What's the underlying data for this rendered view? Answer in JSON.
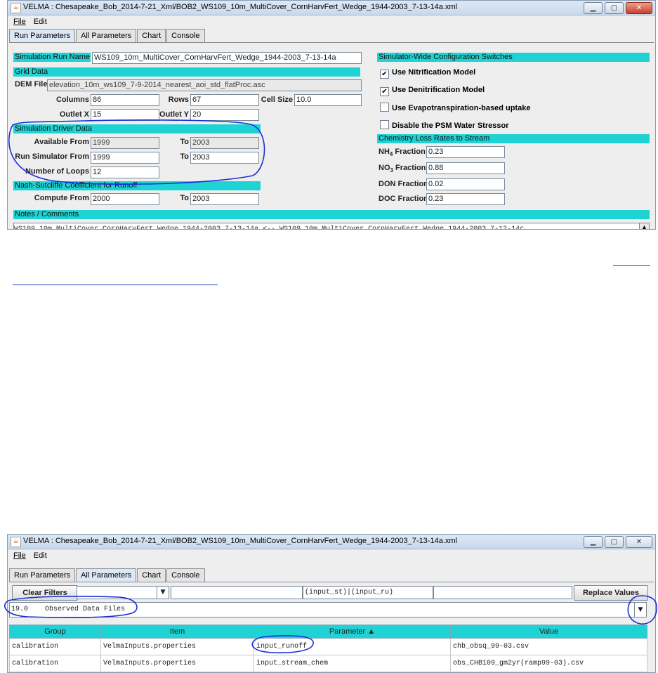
{
  "window1": {
    "title": "VELMA : Chesapeake_Bob_2014-7-21_Xml/BOB2_WS109_10m_MultiCover_CornHarvFert_Wedge_1944-2003_7-13-14a.xml",
    "menu": [
      "File",
      "Edit"
    ],
    "tabs": [
      "Run Parameters",
      "All Parameters",
      "Chart",
      "Console"
    ],
    "active_tab": "Run Parameters",
    "sim_run_name_label": "Simulation Run Name",
    "sim_run_name_value": "WS109_10m_MultiCover_CornHarvFert_Wedge_1944-2003_7-13-14a",
    "grid_data_header": "Grid Data",
    "dem_file_label": "DEM File",
    "dem_file_value": "elevation_10m_ws109_7-9-2014_nearest_aoi_std_flatProc.asc",
    "columns_label": "Columns",
    "columns_value": "86",
    "rows_label": "Rows",
    "rows_value": "67",
    "cell_size_label": "Cell Size",
    "cell_size_value": "10.0",
    "outlet_x_label": "Outlet X",
    "outlet_x_value": "15",
    "outlet_y_label": "Outlet Y",
    "outlet_y_value": "20",
    "driver_header": "Simulation Driver Data",
    "available_from_label": "Available From",
    "available_from_value": "1999",
    "available_to_label": "To",
    "available_to_value": "2003",
    "run_from_label": "Run Simulator From",
    "run_from_value": "1999",
    "run_to_label": "To",
    "run_to_value": "2003",
    "loops_label": "Number of Loops",
    "loops_value": "12",
    "nash_header": "Nash-Sutcliffe Coefficient for Runoff",
    "compute_from_label": "Compute From",
    "compute_from_value": "2000",
    "compute_to_label": "To",
    "compute_to_value": "2003",
    "switches_header": "Simulator-Wide Configuration Switches",
    "switches": [
      {
        "label": "Use Nitrification Model",
        "checked": true
      },
      {
        "label": "Use Denitrification Model",
        "checked": true
      },
      {
        "label": "Use Evapotranspiration-based uptake",
        "checked": false
      },
      {
        "label": "Disable the PSM Water Stressor",
        "checked": false
      }
    ],
    "chem_header": "Chemistry Loss Rates to Stream",
    "nh4_main": "NH",
    "nh4_sub": "4",
    "nh4_rest": " Fraction",
    "nh4_value": "0.23",
    "no3_main": "NO",
    "no3_sub": "3",
    "no3_rest": " Fraction",
    "no3_value": "0.88",
    "don_label": "DON Fraction",
    "don_value": "0.02",
    "doc_label": "DOC Fraction",
    "doc_value": "0.23",
    "notes_header": "Notes / Comments",
    "notes_text": "WS109_10m_MultiCover_CornHarvFert_Wedge_1944-2003_7-13-14a <-- WS109_10m_MultiCover_CornHarvFert_Wedge_1944-2003_7-12-14c"
  },
  "window2": {
    "title": "VELMA : Chesapeake_Bob_2014-7-21_Xml/BOB2_WS109_10m_MultiCover_CornHarvFert_Wedge_1944-2003_7-13-14a.xml",
    "menu": [
      "File",
      "Edit"
    ],
    "tabs": [
      "Run Parameters",
      "All Parameters",
      "Chart",
      "Console"
    ],
    "active_tab": "All Parameters",
    "clear_filters": "Clear Filters",
    "filter_text": "(input_st)|(input_ru)",
    "replace_values": "Replace Values",
    "category_value": "19.0    Observed Data Files",
    "columns": [
      "Group",
      "Item",
      "Parameter ▲",
      "Value"
    ],
    "rows": [
      [
        "calibration",
        "VelmaInputs.properties",
        "input_runoff",
        "chb_obsq_99-03.csv"
      ],
      [
        "calibration",
        "VelmaInputs.properties",
        "input_stream_chem",
        "obs_CHB109_gm2yr(ramp99-03).csv"
      ]
    ]
  },
  "icons": {
    "app_icon": "java-cup-icon",
    "minimize": "minimize-icon",
    "maximize": "maximize-icon",
    "close": "close-icon",
    "dropdown": "chevron-down-icon",
    "checkmark": "check-icon"
  },
  "colors": {
    "section_header": "#1fd3d5",
    "annotation": "#1a2fd6",
    "link": "#1f3eb8"
  }
}
